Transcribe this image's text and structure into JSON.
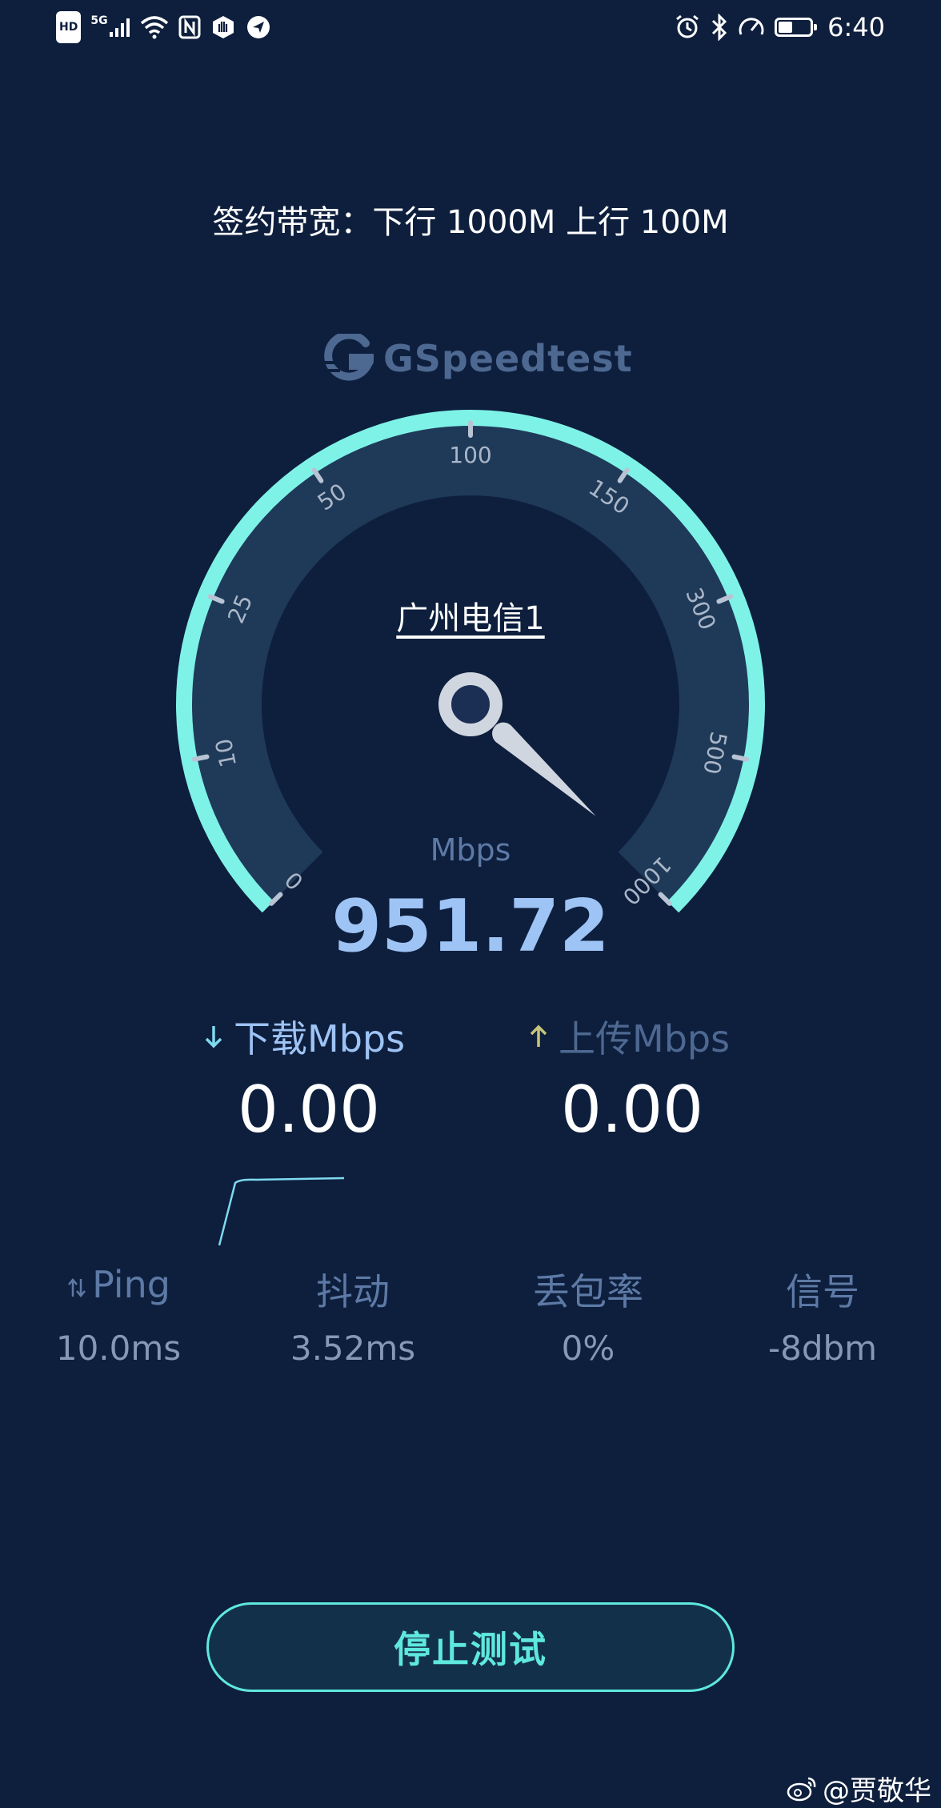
{
  "status_bar": {
    "left_badges": {
      "hd": "HD",
      "network": "5G"
    },
    "time": "6:40",
    "battery_level": 0.45
  },
  "plan": {
    "text": "签约带宽：下行 1000M  上行 100M"
  },
  "logo": {
    "text": "GSpeedtest"
  },
  "gauge": {
    "ticks": [
      "0",
      "10",
      "25",
      "50",
      "100",
      "150",
      "300",
      "500",
      "1000"
    ],
    "server_name": "广州电信1",
    "unit": "Mbps",
    "current_speed": "951.72",
    "needle_value": 951.72,
    "colors": {
      "arc": "#7ff2e8",
      "track": "#1f3a58",
      "needle": "#d0d6df"
    }
  },
  "download": {
    "label": "下载Mbps",
    "value": "0.00",
    "arrow_color": "#7fd9f0"
  },
  "upload": {
    "label": "上传Mbps",
    "value": "0.00",
    "arrow_color": "#c6c57a"
  },
  "stats": [
    {
      "label": "Ping",
      "value": "10.0ms"
    },
    {
      "label": "抖动",
      "value": "3.52ms"
    },
    {
      "label": "丢包率",
      "value": "0%"
    },
    {
      "label": "信号",
      "value": "-8dbm"
    }
  ],
  "stop_button": {
    "label": "停止测试"
  },
  "watermark": {
    "text": "@贾敬华"
  }
}
